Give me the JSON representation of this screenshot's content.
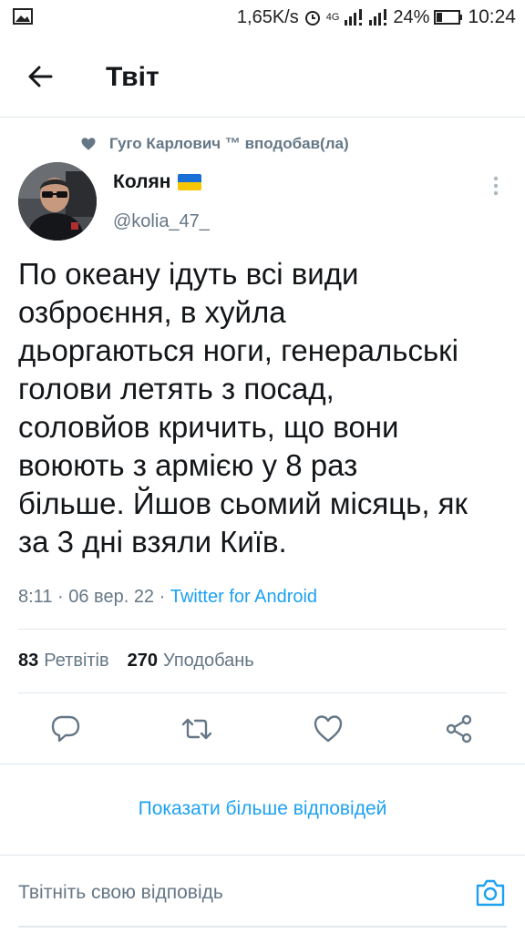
{
  "status_bar": {
    "speed": "1,65K/s",
    "network": "4G",
    "battery": "24%",
    "time": "10:24"
  },
  "header": {
    "title": "Твіт"
  },
  "liked_by": {
    "text": "Гуго Карлович ™ вподобав(ла)"
  },
  "author": {
    "name": "Колян",
    "handle": "@kolia_47_"
  },
  "tweet": {
    "text": "По океану ідуть всі види\nозброєння, в хуйла\nдьоргаються ноги, генеральські\nголови летять з посад,\nсоловйов кричить, що вони\nвоюють з армією у 8 раз\nбільше. Йшов сьомий місяць, як\nза 3 дні взяли Київ.",
    "time": "8:11",
    "date": "06 вер. 22",
    "source": "Twitter for Android",
    "separator": "·"
  },
  "stats": {
    "retweets_count": "83",
    "retweets_label": "Ретвітів",
    "likes_count": "270",
    "likes_label": "Уподобань"
  },
  "more_replies": "Показати більше відповідей",
  "reply_placeholder": "Твітніть свою відповідь",
  "colors": {
    "accent": "#1da1f2",
    "muted": "#657786",
    "text": "#14171a",
    "divider": "#e1e8ed"
  },
  "icons": {
    "back": "arrow-left-icon",
    "liked": "heart-filled-icon",
    "more": "more-vertical-icon",
    "reply": "reply-icon",
    "retweet": "retweet-icon",
    "like": "heart-outline-icon",
    "share": "share-icon",
    "camera": "camera-icon"
  }
}
